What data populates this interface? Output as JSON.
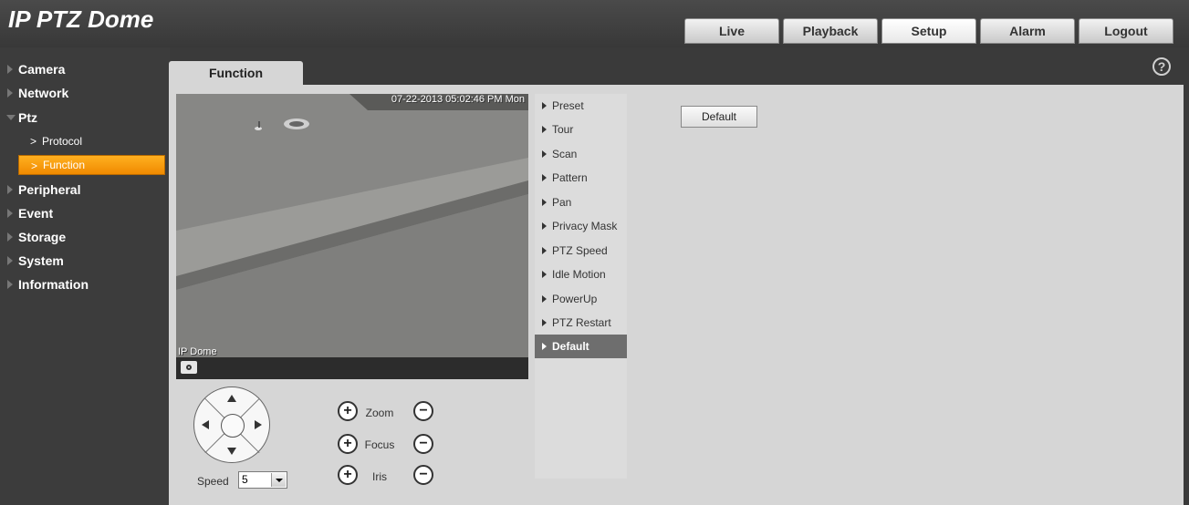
{
  "app": {
    "title": "IP PTZ Dome"
  },
  "nav": {
    "tabs": [
      "Live",
      "Playback",
      "Setup",
      "Alarm",
      "Logout"
    ],
    "active": "Setup"
  },
  "sidebar": {
    "items": [
      {
        "label": "Camera"
      },
      {
        "label": "Network"
      },
      {
        "label": "Ptz"
      },
      {
        "label": "Protocol"
      },
      {
        "label": "Function"
      },
      {
        "label": "Peripheral"
      },
      {
        "label": "Event"
      },
      {
        "label": "Storage"
      },
      {
        "label": "System"
      },
      {
        "label": "Information"
      }
    ],
    "active": "Function",
    "expanded": "Ptz"
  },
  "content": {
    "tab": "Function",
    "help_icon": "help-icon"
  },
  "video": {
    "timestamp": "07-22-2013 05:02:46 PM Mon",
    "channel_name": "IP Dome"
  },
  "menu": {
    "items": [
      {
        "label": "Preset"
      },
      {
        "label": "Tour"
      },
      {
        "label": "Scan"
      },
      {
        "label": "Pattern"
      },
      {
        "label": "Pan"
      },
      {
        "label": "Privacy Mask"
      },
      {
        "label": "PTZ Speed"
      },
      {
        "label": "Idle Motion"
      },
      {
        "label": "PowerUp"
      },
      {
        "label": "PTZ Restart"
      },
      {
        "label": "Default"
      }
    ],
    "active": "Default"
  },
  "default_panel": {
    "button_label": "Default"
  },
  "ptz_controls": {
    "speed_label": "Speed",
    "speed_value": "5",
    "zoom_label": "Zoom",
    "focus_label": "Focus",
    "iris_label": "Iris",
    "plus": "+",
    "minus": "−"
  },
  "colors": {
    "accent": "#f59a00",
    "background": "#3a3a3a",
    "panel": "#d6d6d6"
  }
}
